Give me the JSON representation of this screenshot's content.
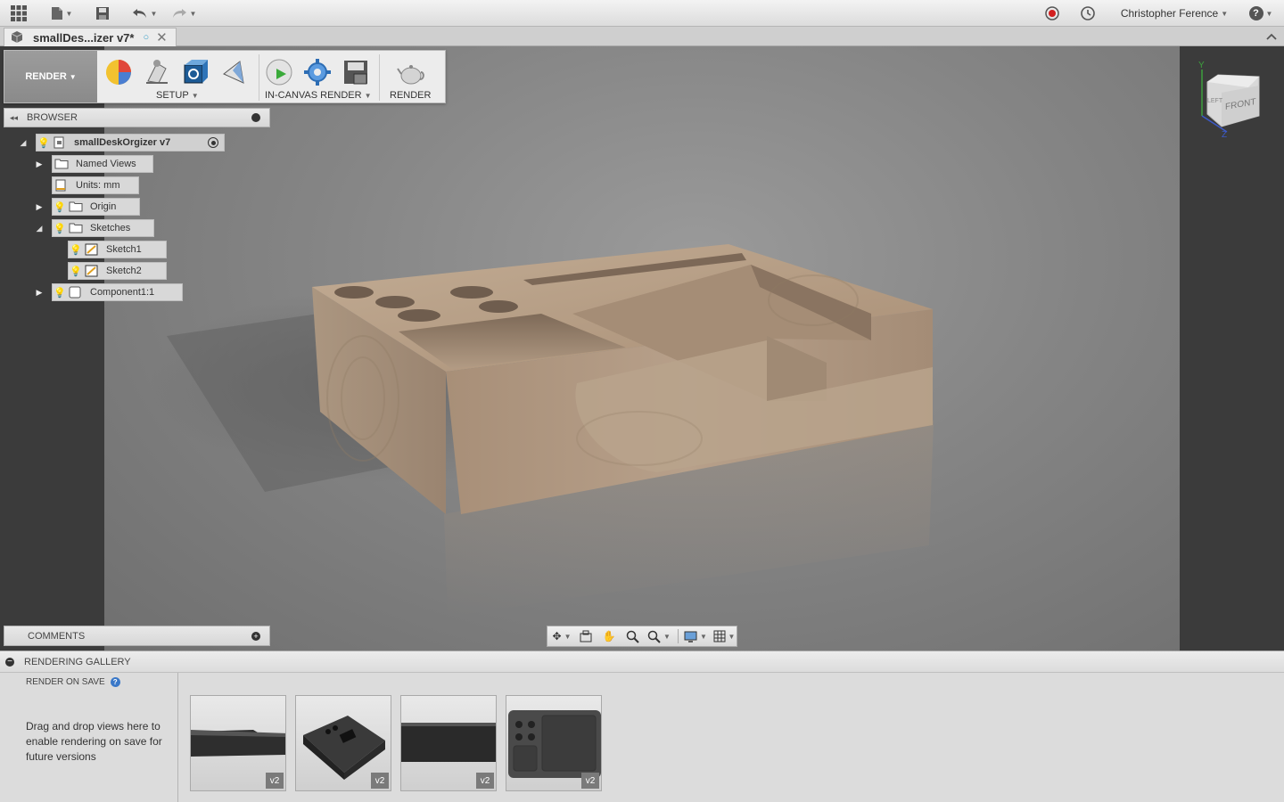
{
  "app": {
    "user_name": "Christopher Ference",
    "help_label": "?"
  },
  "tab": {
    "title": "smallDes...izer v7*"
  },
  "toolbar": {
    "workspace": "RENDER",
    "setup_label": "SETUP",
    "in_canvas_label": "IN-CANVAS RENDER",
    "render_label": "RENDER"
  },
  "browser": {
    "header": "BROWSER",
    "root": "smallDeskOrgizer v7",
    "named_views": "Named Views",
    "units": "Units: mm",
    "origin": "Origin",
    "sketches": "Sketches",
    "sketch1": "Sketch1",
    "sketch2": "Sketch2",
    "component": "Component1:1"
  },
  "comments": {
    "header": "COMMENTS"
  },
  "viewcube": {
    "front": "FRONT",
    "left": "LEFT",
    "axis_y": "Y",
    "axis_z": "Z"
  },
  "gallery": {
    "header": "RENDERING GALLERY",
    "render_on_save": "RENDER ON SAVE",
    "hint": "Drag and drop views here to enable rendering on save for future versions",
    "thumbs": [
      {
        "version": "v2"
      },
      {
        "version": "v2"
      },
      {
        "version": "v2"
      },
      {
        "version": "v2"
      }
    ]
  },
  "colors": {
    "wood": "#b79f86",
    "wood_dark": "#8d7660",
    "panel": "#3b3b3b",
    "accent_record": "#d21f1f"
  }
}
